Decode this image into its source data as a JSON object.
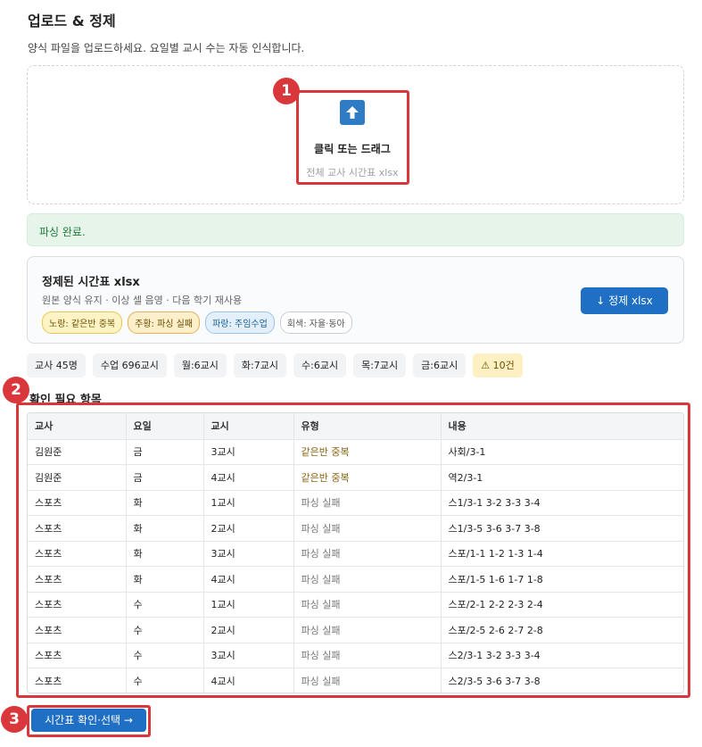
{
  "header": {
    "title": "업로드 & 정제",
    "subtitle": "양식 파일을 업로드하세요. 요일별 교시 수는 자동 인식합니다."
  },
  "upload": {
    "icon": "upload-arrow-icon",
    "label": "클릭 또는 드래그",
    "hint": "전체 교사 시간표 xlsx"
  },
  "status": {
    "message": "파싱 완료."
  },
  "result": {
    "title": "정제된 시간표 xlsx",
    "subtitle": "원본 양식 유지 · 이상 셀 음영 · 다음 학기 재사용",
    "legend": [
      {
        "label": "노랑: 같은반 중복"
      },
      {
        "label": "주황: 파싱 실패"
      },
      {
        "label": "파랑: 주임수업"
      },
      {
        "label": "회색: 자율·동아"
      }
    ],
    "download_label": "↓ 정제 xlsx"
  },
  "stats": {
    "teachers": "교사 45명",
    "classes": "수업 696교시",
    "mon": "월:6교시",
    "tue": "화:7교시",
    "wed": "수:6교시",
    "thu": "목:7교시",
    "fri": "금:6교시",
    "warnings": "⚠ 10건"
  },
  "review": {
    "title": "확인 필요 항목",
    "columns": [
      "교사",
      "요일",
      "교시",
      "유형",
      "내용"
    ],
    "rows": [
      [
        "김원준",
        "금",
        "3교시",
        "같은반 중복",
        "사회/3-1"
      ],
      [
        "김원준",
        "금",
        "4교시",
        "같은반 중복",
        "역2/3-1"
      ],
      [
        "스포츠",
        "화",
        "1교시",
        "파싱 실패",
        "스1/3-1 3-2 3-3 3-4"
      ],
      [
        "스포츠",
        "화",
        "2교시",
        "파싱 실패",
        "스1/3-5 3-6 3-7 3-8"
      ],
      [
        "스포츠",
        "화",
        "3교시",
        "파싱 실패",
        "스포/1-1 1-2 1-3 1-4"
      ],
      [
        "스포츠",
        "화",
        "4교시",
        "파싱 실패",
        "스포/1-5 1-6 1-7 1-8"
      ],
      [
        "스포츠",
        "수",
        "1교시",
        "파싱 실패",
        "스포/2-1 2-2 2-3 2-4"
      ],
      [
        "스포츠",
        "수",
        "2교시",
        "파싱 실패",
        "스포/2-5 2-6 2-7 2-8"
      ],
      [
        "스포츠",
        "수",
        "3교시",
        "파싱 실패",
        "스2/3-1 3-2 3-3 3-4"
      ],
      [
        "스포츠",
        "수",
        "4교시",
        "파싱 실패",
        "스2/3-5 3-6 3-7 3-8"
      ]
    ]
  },
  "confirm_button": "시간표 확인·선택 →",
  "callouts": [
    "1",
    "2",
    "3"
  ],
  "colors": {
    "accent": "#1f6fc5",
    "callout": "#d9373b",
    "success_bg": "#e6f4ea"
  }
}
